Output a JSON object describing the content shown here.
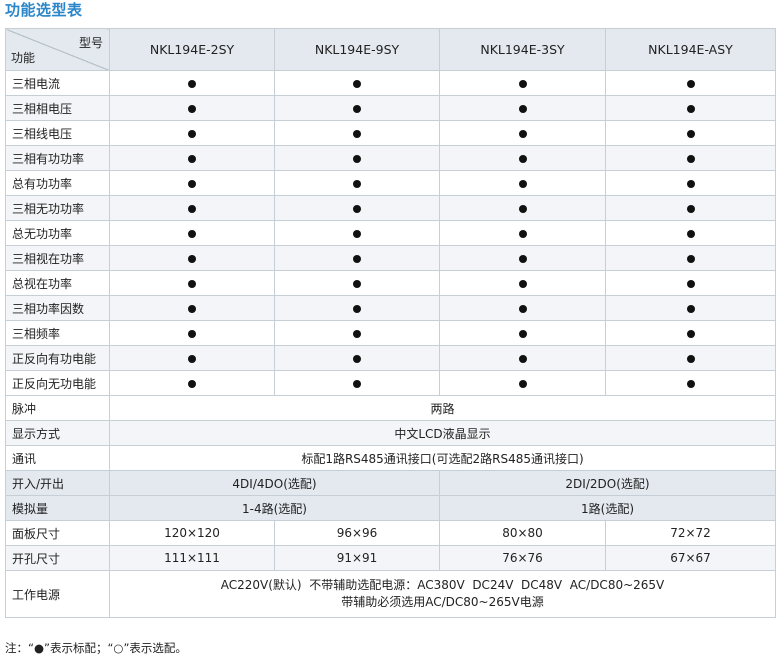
{
  "title": "功能选型表",
  "header": {
    "corner_top": "型号",
    "corner_bottom": "功能",
    "models": [
      "NKL194E-2SY",
      "NKL194E-9SY",
      "NKL194E-3SY",
      "NKL194E-ASY"
    ]
  },
  "functions": [
    {
      "label": "三相电流",
      "marks": [
        "●",
        "●",
        "●",
        "●"
      ]
    },
    {
      "label": "三相相电压",
      "marks": [
        "●",
        "●",
        "●",
        "●"
      ]
    },
    {
      "label": "三相线电压",
      "marks": [
        "●",
        "●",
        "●",
        "●"
      ]
    },
    {
      "label": "三相有功功率",
      "marks": [
        "●",
        "●",
        "●",
        "●"
      ]
    },
    {
      "label": "总有功功率",
      "marks": [
        "●",
        "●",
        "●",
        "●"
      ]
    },
    {
      "label": "三相无功功率",
      "marks": [
        "●",
        "●",
        "●",
        "●"
      ]
    },
    {
      "label": "总无功功率",
      "marks": [
        "●",
        "●",
        "●",
        "●"
      ]
    },
    {
      "label": "三相视在功率",
      "marks": [
        "●",
        "●",
        "●",
        "●"
      ]
    },
    {
      "label": "总视在功率",
      "marks": [
        "●",
        "●",
        "●",
        "●"
      ]
    },
    {
      "label": "三相功率因数",
      "marks": [
        "●",
        "●",
        "●",
        "●"
      ]
    },
    {
      "label": "三相频率",
      "marks": [
        "●",
        "●",
        "●",
        "●"
      ]
    },
    {
      "label": "正反向有功电能",
      "marks": [
        "●",
        "●",
        "●",
        "●"
      ]
    },
    {
      "label": "正反向无功电能",
      "marks": [
        "●",
        "●",
        "●",
        "●"
      ]
    }
  ],
  "pulse": {
    "label": "脉冲",
    "value": "两路"
  },
  "display": {
    "label": "显示方式",
    "value": "中文LCD液晶显示"
  },
  "comm": {
    "label": "通讯",
    "value": "标配1路RS485通讯接口(可选配2路RS485通讯接口)"
  },
  "io": {
    "label": "开入/开出",
    "left": "4DI/4DO(选配)",
    "right": "2DI/2DO(选配)"
  },
  "analog": {
    "label": "模拟量",
    "left": "1-4路(选配)",
    "right": "1路(选配)"
  },
  "panel": {
    "label": "面板尺寸",
    "values": [
      "120×120",
      "96×96",
      "80×80",
      "72×72"
    ]
  },
  "cutout": {
    "label": "开孔尺寸",
    "values": [
      "111×111",
      "91×91",
      "76×76",
      "67×67"
    ]
  },
  "power": {
    "label": "工作电源",
    "line1": "AC220V(默认)  不带辅助选配电源：AC380V  DC24V  DC48V  AC/DC80~265V",
    "line2": "带辅助必须选用AC/DC80~265V电源"
  },
  "note": "注：“●”表示标配；“○”表示选配。"
}
